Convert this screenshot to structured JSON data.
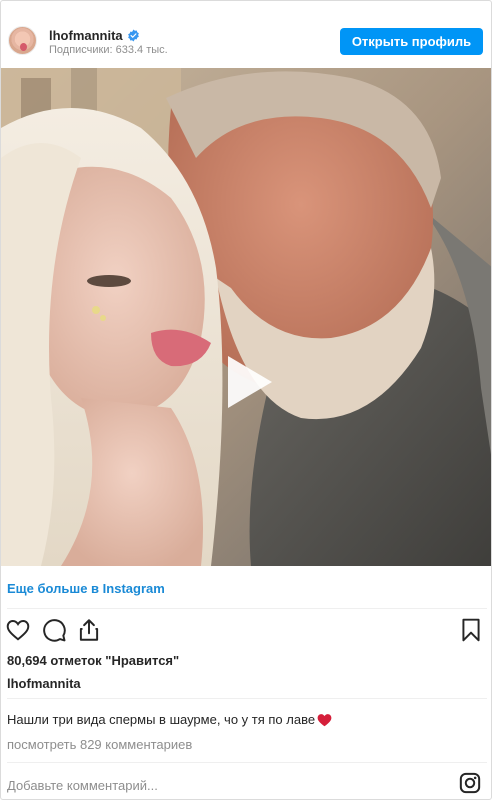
{
  "header": {
    "username": "lhofmannita",
    "followers": "Подписчики: 633.4 тыс.",
    "open_profile_label": "Открыть профиль"
  },
  "media": {
    "type": "video",
    "icon": "play-icon"
  },
  "more_link": "Еще больше в Instagram",
  "actions": {
    "icons": [
      "heart-icon",
      "comment-icon",
      "share-icon",
      "bookmark-icon"
    ]
  },
  "likes": "80,694 отметок \"Нравится\"",
  "author": "lhofmannita",
  "caption": "Нашли три вида спермы в шаурме, чо у тя по лаве",
  "caption_emoji": "heart-emoji",
  "view_comments": "посмотреть 829 комментариев",
  "comment_placeholder": "Добавьте комментарий...",
  "colors": {
    "accent": "#0095f6",
    "link": "#1a8ad6",
    "muted": "#8e8e8e",
    "text": "#262626"
  }
}
